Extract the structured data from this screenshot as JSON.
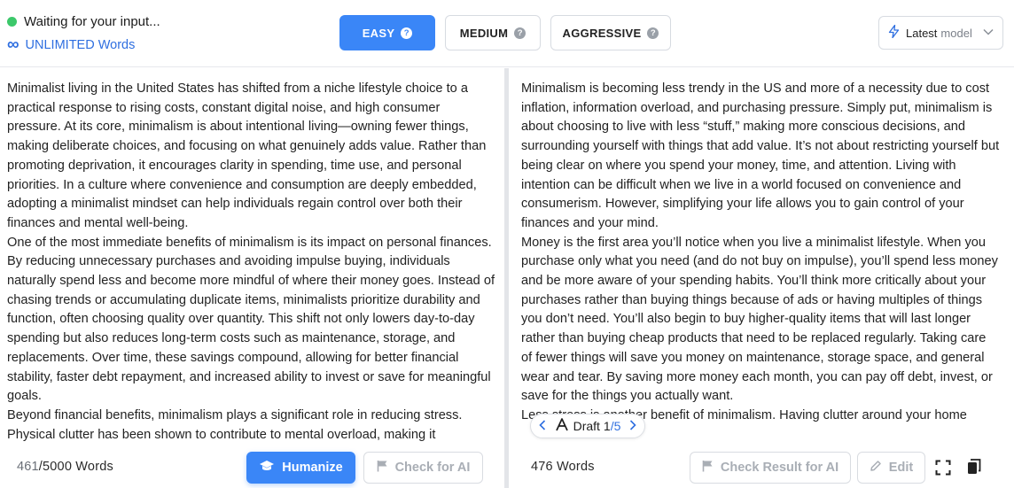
{
  "header": {
    "status_text": "Waiting for your input...",
    "status_color": "#3cc86a",
    "unlimited_icon": "infinity-icon",
    "unlimited_text": "UNLIMITED Words",
    "modes": [
      {
        "label": "EASY",
        "active": true
      },
      {
        "label": "MEDIUM",
        "active": false
      },
      {
        "label": "AGGRESSIVE",
        "active": false
      }
    ],
    "help_glyph": "?",
    "model": {
      "icon": "bolt-icon",
      "label": "Latest",
      "suffix": "model"
    },
    "accent_color": "#3a86f7"
  },
  "left": {
    "paragraphs": [
      "Minimalist living in the United States has shifted from a niche lifestyle choice to a practical response to rising costs, constant digital noise, and high consumer pressure. At its core, minimalism is about intentional living—owning fewer things, making deliberate choices, and focusing on what genuinely adds value. Rather than promoting deprivation, it encourages clarity in spending, time use, and personal priorities. In a culture where convenience and consumption are deeply embedded, adopting a minimalist mindset can help individuals regain control over both their finances and mental well-being.",
      "One of the most immediate benefits of minimalism is its impact on personal finances. By reducing unnecessary purchases and avoiding impulse buying, individuals naturally spend less and become more mindful of where their money goes. Instead of chasing trends or accumulating duplicate items, minimalists prioritize durability and function, often choosing quality over quantity. This shift not only lowers day-to-day spending but also reduces long-term costs such as maintenance, storage, and replacements. Over time, these savings compound, allowing for better financial stability, faster debt repayment, and increased ability to invest or save for meaningful goals.",
      "Beyond financial benefits, minimalism plays a significant role in reducing stress. Physical clutter has been shown to contribute to mental overload, making it"
    ],
    "word_count": "461",
    "word_limit": "/5000 Words",
    "humanize_label": "Humanize",
    "check_label": "Check for AI"
  },
  "right": {
    "paragraphs": [
      "Minimalism is becoming less trendy in the US and more of a necessity due to cost inflation, information overload, and purchasing pressure. Simply put, minimalism is about choosing to live with less “stuff,” making more conscious decisions, and surrounding yourself with things that add value. It’s not about restricting yourself but being clear on where you spend your money, time, and attention. Living with intention can be difficult when we live in a world focused on convenience and consumerism. However, simplifying your life allows you to gain control of your finances and your mind.",
      "Money is the first area you’ll notice when you live a minimalist lifestyle. When you purchase only what you need (and do not buy on impulse), you’ll spend less money and be more aware of your spending habits. You’ll think more critically about your purchases rather than buying things because of ads or having multiples of things you don’t need. You’ll also begin to buy higher-quality items that will last longer rather than buying cheap products that need to be replaced regularly. Taking care of fewer things will save you money on maintenance, storage space, and general wear and tear. By saving more money each month, you can pay off debt, invest, or save for the things you actually want.",
      "Less stress is another benefit of minimalism. Having clutter around your home"
    ],
    "word_count": "476 Words",
    "draft": {
      "label": "Draft",
      "current": "1",
      "total": "/5"
    },
    "check_result_label": "Check Result for AI",
    "edit_label": "Edit"
  }
}
